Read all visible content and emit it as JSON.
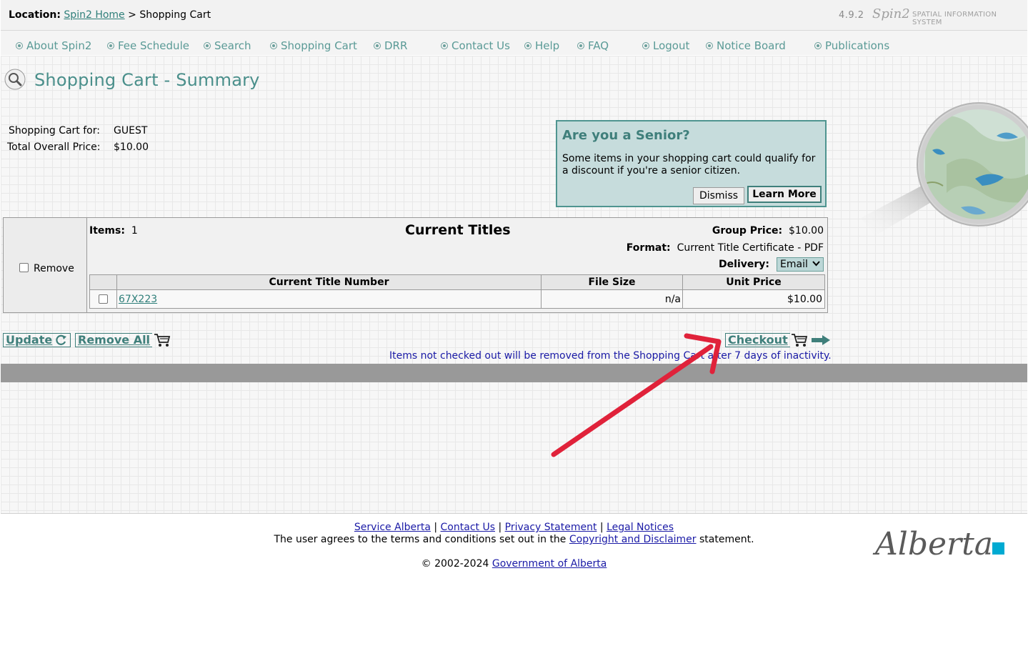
{
  "header": {
    "location_label": "Location:",
    "home_link": "Spin2 Home",
    "separator": ">",
    "current": "Shopping Cart",
    "version": "4.9.2",
    "logo_text": "Spin2",
    "system_name": "SPATIAL INFORMATION SYSTEM"
  },
  "nav": {
    "items": [
      {
        "label": "About Spin2"
      },
      {
        "label": "Fee Schedule"
      },
      {
        "label": "Search"
      },
      {
        "label": "Shopping Cart"
      },
      {
        "label": "DRR"
      },
      {
        "label": "Contact Us"
      },
      {
        "label": "Help"
      },
      {
        "label": "FAQ"
      },
      {
        "label": "Logout"
      },
      {
        "label": "Notice Board"
      },
      {
        "label": "Publications"
      }
    ]
  },
  "page": {
    "title": "Shopping Cart - Summary"
  },
  "summary": {
    "cart_for_label": "Shopping Cart for:",
    "cart_for_value": "GUEST",
    "total_label": "Total Overall Price:",
    "total_value": "$10.00"
  },
  "senior": {
    "title": "Are you a Senior?",
    "text": "Some items in your shopping cart could qualify for a discount if you're a senior citizen.",
    "dismiss": "Dismiss",
    "learn_more": "Learn More"
  },
  "cart": {
    "remove_label": "Remove",
    "items_label": "Items:",
    "items_value": "1",
    "group_title": "Current Titles",
    "group_price_label": "Group Price:",
    "group_price_value": "$10.00",
    "format_label": "Format:",
    "format_value": "Current Title Certificate - PDF",
    "delivery_label": "Delivery:",
    "delivery_value": "Email",
    "columns": [
      "Current Title Number",
      "File Size",
      "Unit Price"
    ],
    "rows": [
      {
        "title_number": "67X223",
        "file_size": "n/a",
        "unit_price": "$10.00"
      }
    ]
  },
  "actions": {
    "update": "Update",
    "remove_all": "Remove All",
    "checkout": "Checkout",
    "notice": "Items not checked out will be removed from the Shopping Cart after 7 days of inactivity."
  },
  "footer": {
    "links": [
      "Service Alberta",
      "Contact Us",
      "Privacy Statement",
      "Legal Notices"
    ],
    "link_sep": "|",
    "terms_pre": "The user agrees to the terms and conditions set out in the",
    "terms_link": "Copyright and Disclaimer",
    "terms_post": "statement.",
    "copyright_pre": "© 2002-2024",
    "copyright_link": "Government of Alberta",
    "logo_text": "Alberta"
  },
  "colors": {
    "accent": "#4a8f8b",
    "senior_bg": "#c6dcdc",
    "annotation": "#e0223a"
  },
  "icons": [
    "magnifier-icon",
    "refresh-icon",
    "cart-icon",
    "arrow-right-icon",
    "chevron-down-icon"
  ]
}
